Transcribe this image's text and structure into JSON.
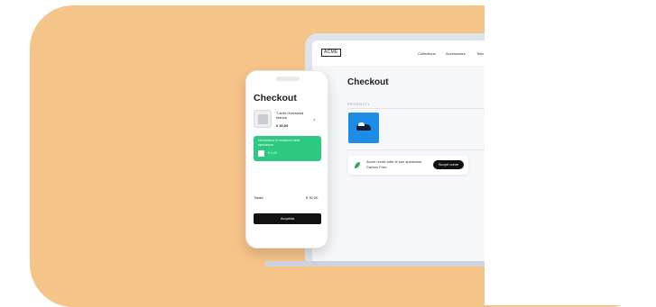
{
  "colors": {
    "card_background": "#f5c489",
    "accent_green": "#2ec981",
    "product_blue": "#1c8ce6",
    "button_black": "#111111"
  },
  "laptop": {
    "logo": "ACME",
    "nav_links": [
      "Collections",
      "Accessories",
      "Tshir"
    ],
    "title": "Checkout",
    "section_label": "PRODOTTI",
    "carbon_banner": {
      "text": "Acme rende tutte le sue spedizioni Carbon Free.",
      "button": "Scopri come",
      "icon": "leaf-icon"
    }
  },
  "phone": {
    "title": "Checkout",
    "item": {
      "name": "T-shirt Oversized bianca",
      "price": "€ 30,00",
      "quantity": "1"
    },
    "carbon_offset": {
      "text": "Neutralizza le emissioni della spedizione",
      "amount": "€ 1,00"
    },
    "total_label": "Totale",
    "total_value": "€ 30,00",
    "buy_button": "Acquista"
  }
}
